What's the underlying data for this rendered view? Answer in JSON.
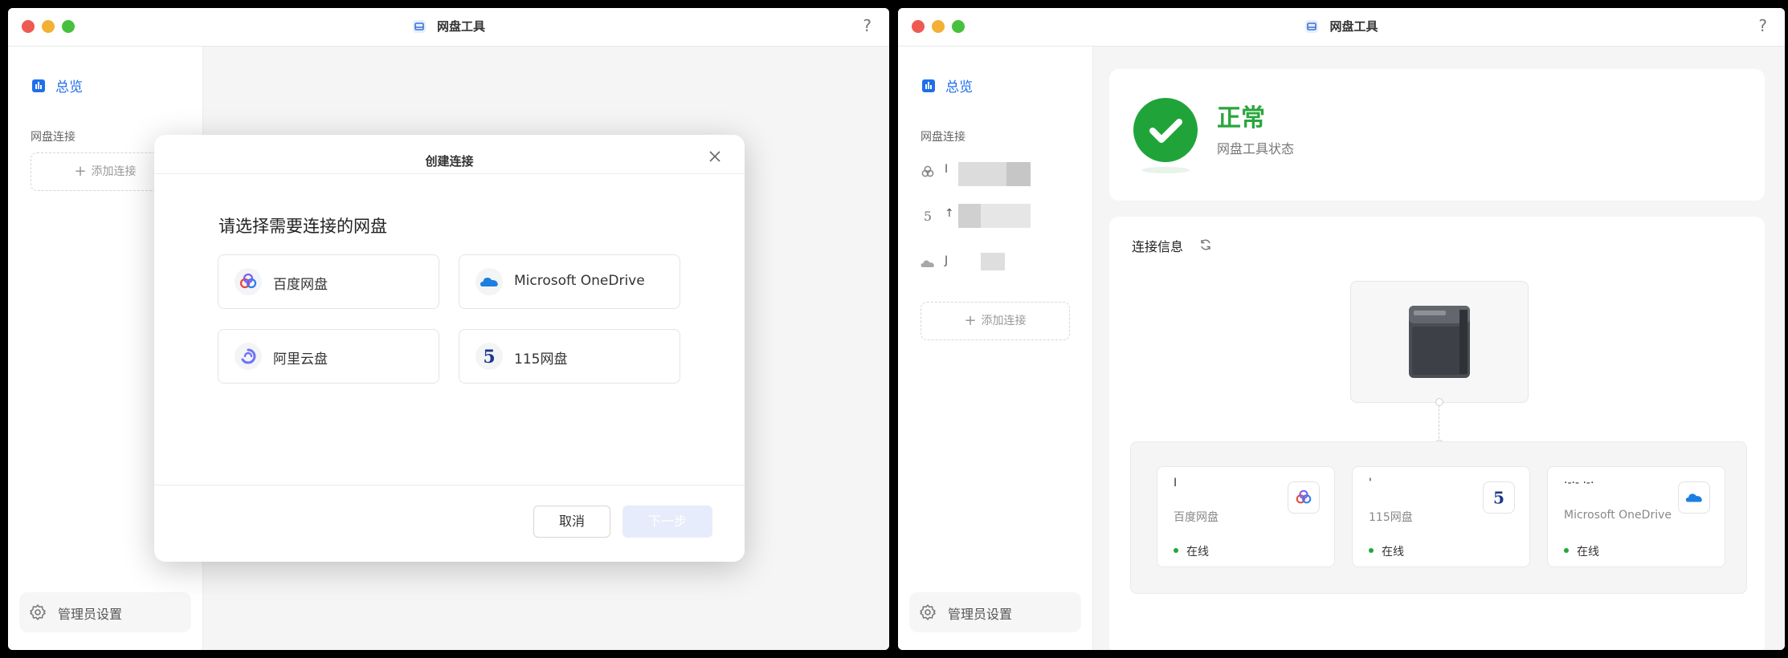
{
  "app": {
    "title": "网盘工具",
    "help": "?"
  },
  "sidebar": {
    "overview_label": "总览",
    "section_label": "网盘连接",
    "add_connection_label": "添加连接",
    "admin_label": "管理员设置",
    "connections": [
      {
        "icon": "baidu-cloud-icon",
        "name": "I"
      },
      {
        "icon": "115-drive-icon",
        "name": "↑"
      },
      {
        "icon": "onedrive-cloud-icon",
        "name": "J"
      }
    ]
  },
  "dialog": {
    "title": "创建连接",
    "heading": "请选择需要连接的网盘",
    "options": [
      {
        "label": "百度网盘",
        "icon": "baidu-cloud-icon"
      },
      {
        "label": "Microsoft OneDrive",
        "icon": "onedrive-icon"
      },
      {
        "label": "阿里云盘",
        "icon": "aliyun-drive-icon"
      },
      {
        "label": "115网盘",
        "icon": "115-drive-icon"
      }
    ],
    "cancel_label": "取消",
    "next_label": "下一步"
  },
  "status": {
    "title": "正常",
    "subtitle": "网盘工具状态"
  },
  "connection_info": {
    "title": "连接信息",
    "cards": [
      {
        "name": "I",
        "type": "百度网盘",
        "status": "在线",
        "icon": "baidu-cloud-icon"
      },
      {
        "name": "'",
        "type": "115网盘",
        "status": "在线",
        "icon": "115-drive-icon"
      },
      {
        "name": "·-·- ·-·",
        "type": "Microsoft OneDrive",
        "status": "在线",
        "icon": "onedrive-icon"
      }
    ]
  },
  "colors": {
    "accent": "#1f6feb",
    "success": "#20a43a",
    "traffic_red": "#ee5a52",
    "traffic_yellow": "#f2b134",
    "traffic_green": "#47c03e"
  }
}
